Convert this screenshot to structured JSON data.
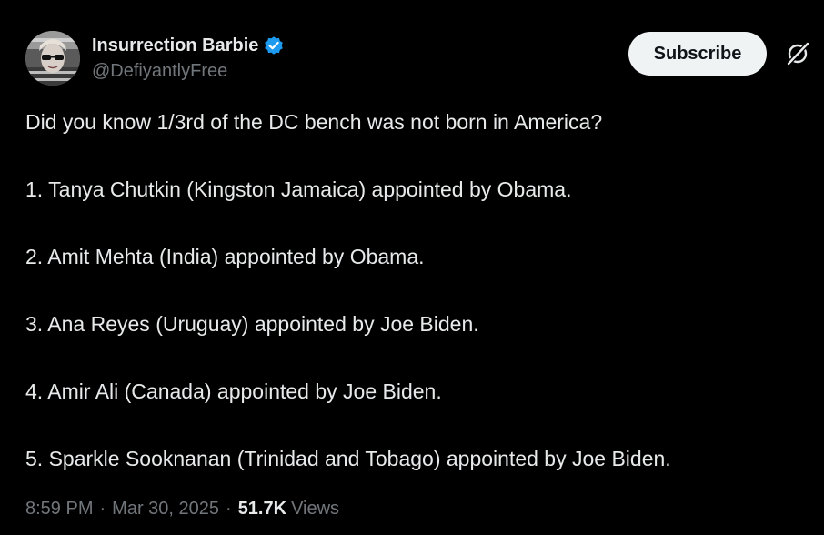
{
  "author": {
    "display_name": "Insurrection Barbie",
    "handle": "@DefiyantlyFree",
    "verified": true,
    "verified_color": "#1d9bf0"
  },
  "actions": {
    "subscribe_label": "Subscribe",
    "grok_icon": "grok-icon"
  },
  "post": {
    "intro": "Did you know 1/3rd of the DC bench was not born in America?",
    "items": [
      "1. Tanya Chutkin (Kingston Jamaica) appointed by Obama.",
      "2. Amit Mehta (India) appointed by Obama.",
      "3. Ana Reyes (Uruguay) appointed by Joe Biden.",
      "4. Amir Ali (Canada) appointed by Joe Biden.",
      "5. Sparkle Sooknanan (Trinidad and Tobago) appointed by Joe Biden."
    ]
  },
  "meta": {
    "time": "8:59 PM",
    "separator": "·",
    "date": "Mar 30, 2025",
    "views_count": "51.7K",
    "views_label": "Views"
  },
  "colors": {
    "background": "#000000",
    "text": "#e7e9ea",
    "secondary_text": "#71767b",
    "button_bg": "#eff3f4"
  }
}
